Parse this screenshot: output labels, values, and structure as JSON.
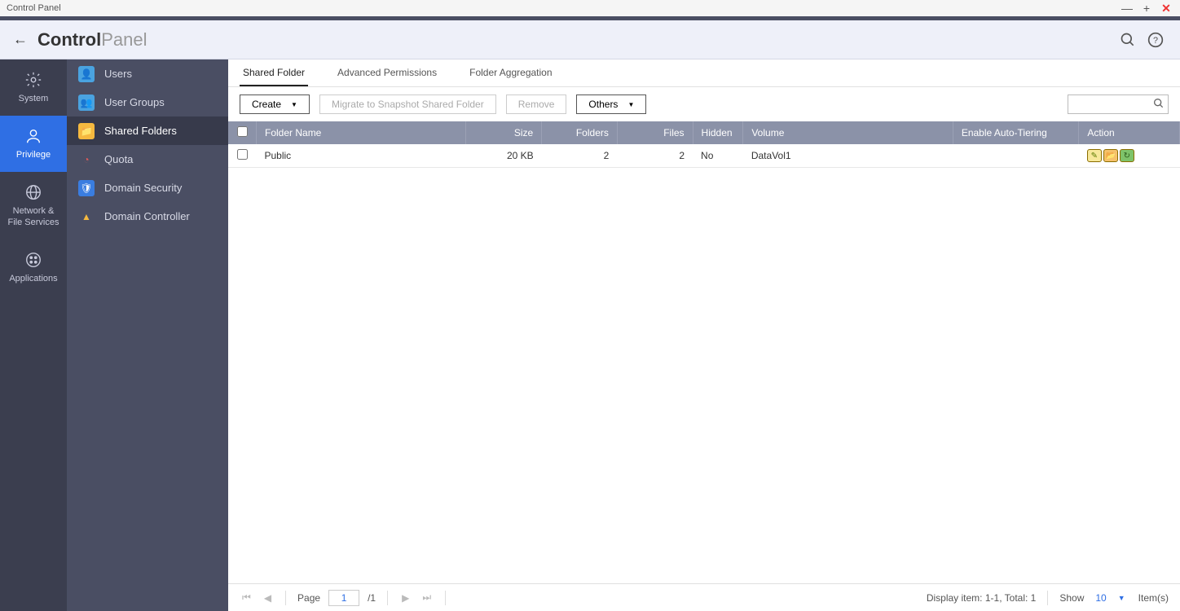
{
  "window": {
    "title": "Control Panel"
  },
  "header": {
    "app_bold": "Control",
    "app_light": "Panel"
  },
  "rail": {
    "items": [
      {
        "label": "System",
        "active": false
      },
      {
        "label": "Privilege",
        "active": true
      },
      {
        "label": "Network &\nFile Services",
        "active": false
      },
      {
        "label": "Applications",
        "active": false
      }
    ]
  },
  "sidenav": {
    "items": [
      {
        "label": "Users",
        "icon_bg": "#4aa3e0",
        "active": false
      },
      {
        "label": "User Groups",
        "icon_bg": "#4aa3e0",
        "active": false
      },
      {
        "label": "Shared Folders",
        "icon_bg": "#f5b93f",
        "active": true
      },
      {
        "label": "Quota",
        "icon_bg": "#ffffff",
        "active": false
      },
      {
        "label": "Domain Security",
        "icon_bg": "#3a7de0",
        "active": false
      },
      {
        "label": "Domain Controller",
        "icon_bg": "#ffffff",
        "active": false
      }
    ]
  },
  "tabs": [
    {
      "label": "Shared Folder",
      "active": true
    },
    {
      "label": "Advanced Permissions",
      "active": false
    },
    {
      "label": "Folder Aggregation",
      "active": false
    }
  ],
  "toolbar": {
    "create": "Create",
    "migrate": "Migrate to Snapshot Shared Folder",
    "remove": "Remove",
    "others": "Others",
    "search_placeholder": ""
  },
  "columns": {
    "folder_name": "Folder Name",
    "size": "Size",
    "folders": "Folders",
    "files": "Files",
    "hidden": "Hidden",
    "volume": "Volume",
    "auto_tier": "Enable Auto-Tiering",
    "action": "Action"
  },
  "rows": [
    {
      "folder_name": "Public",
      "size": "20 KB",
      "folders": "2",
      "files": "2",
      "hidden": "No",
      "volume": "DataVol1",
      "auto_tier": ""
    }
  ],
  "paging": {
    "page_label": "Page",
    "page_value": "1",
    "page_total": "/1",
    "display": "Display item: 1-1, Total: 1",
    "show_label": "Show",
    "show_count": "10",
    "items_label": "Item(s)"
  }
}
